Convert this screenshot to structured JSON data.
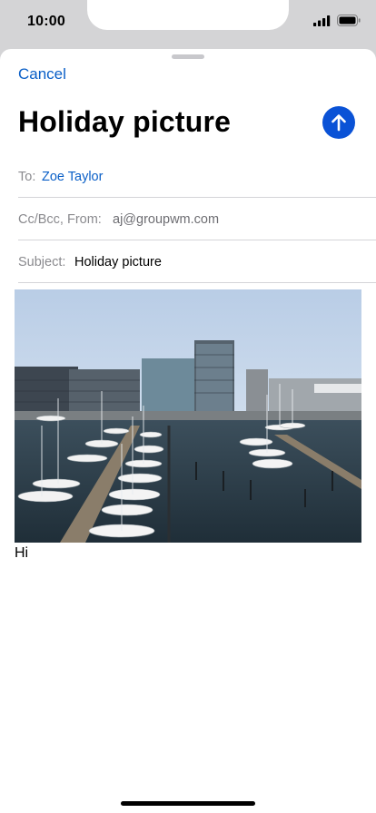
{
  "status_bar": {
    "time": "10:00",
    "icons": [
      "signal-bars-icon",
      "battery-icon"
    ]
  },
  "compose": {
    "cancel_label": "Cancel",
    "title": "Holiday picture",
    "send_icon": "arrow-up-icon",
    "accent_color": "#0a52d6",
    "fields": {
      "to_label": "To:",
      "to_value": "Zoe Taylor",
      "ccbcc_label": "Cc/Bcc, From:",
      "from_value": "aj@groupwm.com",
      "subject_label": "Subject:",
      "subject_value": "Holiday picture"
    },
    "attachment": {
      "type": "photo",
      "description": "harbor marina with boats and modern office buildings"
    },
    "body": "Hi"
  }
}
